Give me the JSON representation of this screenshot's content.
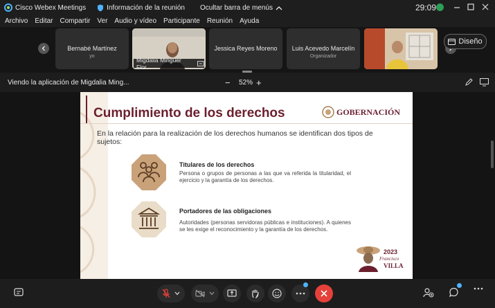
{
  "titlebar": {
    "app_name": "Cisco Webex Meetings",
    "meeting_info": "Información de la reunión",
    "hide_menu": "Ocultar barra de menús",
    "timer": "29:09"
  },
  "menubar": {
    "items": [
      "Archivo",
      "Editar",
      "Compartir",
      "Ver",
      "Audio y vídeo",
      "Participante",
      "Reunión",
      "Ayuda"
    ]
  },
  "participants": [
    {
      "name": "Bernabé Martínez",
      "subtitle": "yo"
    },
    {
      "name": "Migdalia Mingüer Flor..."
    },
    {
      "name": "Jessica Reyes Moreno"
    },
    {
      "name": "Luis Acevedo Marcelín",
      "subtitle": "Organizador"
    }
  ],
  "layout_button": "Diseño",
  "infobar": {
    "viewing": "Viendo la aplicación de Migdalia Ming...",
    "zoom": "52%",
    "zoom_minus": "−",
    "zoom_plus": "+"
  },
  "slide": {
    "title": "Cumplimiento de los derechos",
    "logo_text": "GOBERNACIÓN",
    "intro": "En la relación para la realización de los derechos humanos se identifican dos tipos de sujetos:",
    "items": [
      {
        "heading": "Titulares de los derechos",
        "body": "Persona o grupos de personas a las que va referida la titularidad, el ejercicio y la garantía de los derechos."
      },
      {
        "heading": "Portadores de las obligaciones",
        "body": "Autoridades (personas servidoras públicas e instituciones). A quienes se les exige el reconocimiento y la garantía de los derechos."
      }
    ],
    "emblem_year": "2023",
    "emblem_name1": "Francisco",
    "emblem_name2": "VILLA"
  },
  "colors": {
    "accent_red": "#e5413a",
    "slide_title": "#6b1f2e",
    "octagon": "#c9a27a",
    "active_border": "#d9b36a"
  }
}
